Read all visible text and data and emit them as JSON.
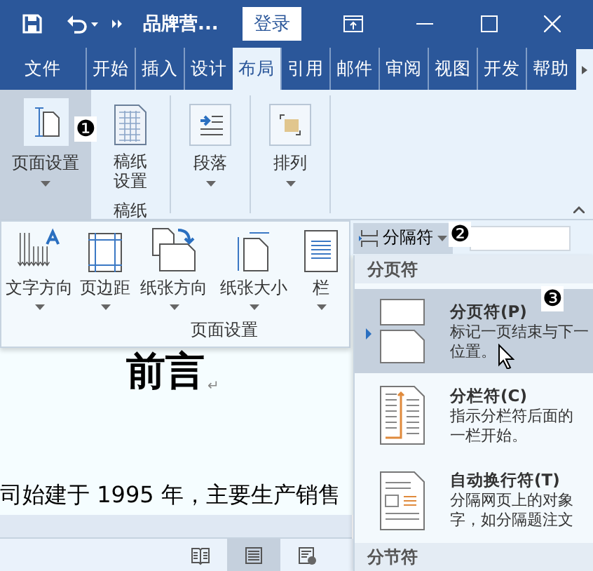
{
  "title_bar": {
    "title": "品牌营...",
    "login": "登录"
  },
  "tabs": [
    {
      "label": "文件",
      "selected": false
    },
    {
      "label": "开始",
      "selected": false
    },
    {
      "label": "插入",
      "selected": false
    },
    {
      "label": "设计",
      "selected": false
    },
    {
      "label": "布局",
      "selected": true
    },
    {
      "label": "引用",
      "selected": false
    },
    {
      "label": "邮件",
      "selected": false
    },
    {
      "label": "审阅",
      "selected": false
    },
    {
      "label": "视图",
      "selected": false
    },
    {
      "label": "开发",
      "selected": false
    },
    {
      "label": "帮助",
      "selected": false
    }
  ],
  "ribbon": {
    "buttons": [
      {
        "kind": "page-setup",
        "label": "页面设置",
        "selected": true,
        "dropdown": true
      },
      {
        "kind": "grid-paper",
        "label": "稿纸设置",
        "selected": false,
        "dropdown": false,
        "group": "稿纸"
      },
      {
        "kind": "paragraph",
        "label": "段落",
        "selected": false,
        "dropdown": true
      },
      {
        "kind": "arrange",
        "label": "排列",
        "selected": false,
        "dropdown": true
      }
    ]
  },
  "page_setup_popup": {
    "items": [
      {
        "kind": "text-direction",
        "label": "文字方向"
      },
      {
        "kind": "margins",
        "label": "页边距"
      },
      {
        "kind": "orientation",
        "label": "纸张方向"
      },
      {
        "kind": "size",
        "label": "纸张大小"
      },
      {
        "kind": "columns",
        "label": "栏"
      }
    ],
    "group_label": "页面设置"
  },
  "breaks_button": {
    "label": "分隔符"
  },
  "breaks_menu": [
    {
      "kind": "header",
      "label": "分页符"
    },
    {
      "kind": "page-break",
      "title": "分页符(P)",
      "lines": [
        "标记一页结束与下一",
        "位置。"
      ],
      "selected": true
    },
    {
      "kind": "column-break",
      "title": "分栏符(C)",
      "lines": [
        "指示分栏符后面的",
        "一栏开始。"
      ],
      "selected": false
    },
    {
      "kind": "text-wrap",
      "title": "自动换行符(T)",
      "lines": [
        "分隔网页上的对象",
        "字，如分隔题注文"
      ],
      "selected": false
    },
    {
      "kind": "header",
      "label": "分节符"
    }
  ],
  "callouts": [
    "❶",
    "❷",
    "❸"
  ],
  "document": {
    "heading": "前言",
    "paragraph_mark": "↵",
    "paragraph": "司始建于 1995 年，主要生产销售"
  },
  "status_bar": {
    "views": [
      {
        "kind": "read",
        "selected": false
      },
      {
        "kind": "print",
        "selected": true
      },
      {
        "kind": "web",
        "selected": false
      }
    ]
  }
}
